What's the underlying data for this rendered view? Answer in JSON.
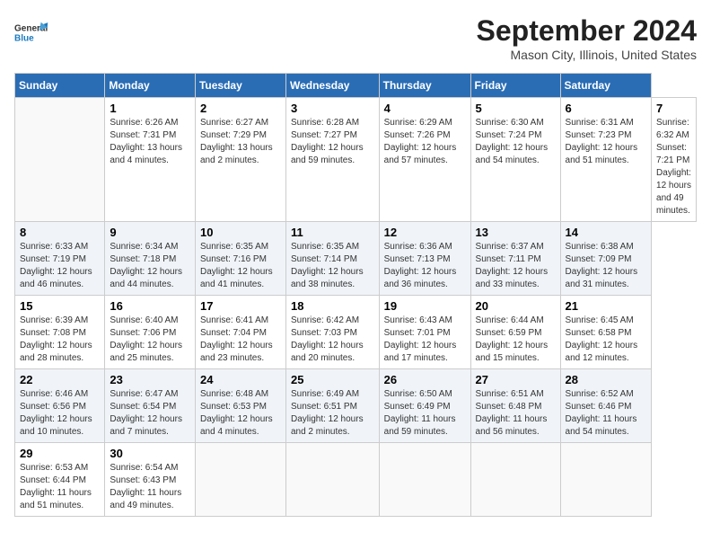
{
  "header": {
    "logo_line1": "General",
    "logo_line2": "Blue",
    "month_title": "September 2024",
    "location": "Mason City, Illinois, United States"
  },
  "calendar": {
    "days_of_week": [
      "Sunday",
      "Monday",
      "Tuesday",
      "Wednesday",
      "Thursday",
      "Friday",
      "Saturday"
    ],
    "weeks": [
      [
        null,
        {
          "day": "1",
          "sunrise": "Sunrise: 6:26 AM",
          "sunset": "Sunset: 7:31 PM",
          "daylight": "Daylight: 13 hours and 4 minutes."
        },
        {
          "day": "2",
          "sunrise": "Sunrise: 6:27 AM",
          "sunset": "Sunset: 7:29 PM",
          "daylight": "Daylight: 13 hours and 2 minutes."
        },
        {
          "day": "3",
          "sunrise": "Sunrise: 6:28 AM",
          "sunset": "Sunset: 7:27 PM",
          "daylight": "Daylight: 12 hours and 59 minutes."
        },
        {
          "day": "4",
          "sunrise": "Sunrise: 6:29 AM",
          "sunset": "Sunset: 7:26 PM",
          "daylight": "Daylight: 12 hours and 57 minutes."
        },
        {
          "day": "5",
          "sunrise": "Sunrise: 6:30 AM",
          "sunset": "Sunset: 7:24 PM",
          "daylight": "Daylight: 12 hours and 54 minutes."
        },
        {
          "day": "6",
          "sunrise": "Sunrise: 6:31 AM",
          "sunset": "Sunset: 7:23 PM",
          "daylight": "Daylight: 12 hours and 51 minutes."
        },
        {
          "day": "7",
          "sunrise": "Sunrise: 6:32 AM",
          "sunset": "Sunset: 7:21 PM",
          "daylight": "Daylight: 12 hours and 49 minutes."
        }
      ],
      [
        {
          "day": "8",
          "sunrise": "Sunrise: 6:33 AM",
          "sunset": "Sunset: 7:19 PM",
          "daylight": "Daylight: 12 hours and 46 minutes."
        },
        {
          "day": "9",
          "sunrise": "Sunrise: 6:34 AM",
          "sunset": "Sunset: 7:18 PM",
          "daylight": "Daylight: 12 hours and 44 minutes."
        },
        {
          "day": "10",
          "sunrise": "Sunrise: 6:35 AM",
          "sunset": "Sunset: 7:16 PM",
          "daylight": "Daylight: 12 hours and 41 minutes."
        },
        {
          "day": "11",
          "sunrise": "Sunrise: 6:35 AM",
          "sunset": "Sunset: 7:14 PM",
          "daylight": "Daylight: 12 hours and 38 minutes."
        },
        {
          "day": "12",
          "sunrise": "Sunrise: 6:36 AM",
          "sunset": "Sunset: 7:13 PM",
          "daylight": "Daylight: 12 hours and 36 minutes."
        },
        {
          "day": "13",
          "sunrise": "Sunrise: 6:37 AM",
          "sunset": "Sunset: 7:11 PM",
          "daylight": "Daylight: 12 hours and 33 minutes."
        },
        {
          "day": "14",
          "sunrise": "Sunrise: 6:38 AM",
          "sunset": "Sunset: 7:09 PM",
          "daylight": "Daylight: 12 hours and 31 minutes."
        }
      ],
      [
        {
          "day": "15",
          "sunrise": "Sunrise: 6:39 AM",
          "sunset": "Sunset: 7:08 PM",
          "daylight": "Daylight: 12 hours and 28 minutes."
        },
        {
          "day": "16",
          "sunrise": "Sunrise: 6:40 AM",
          "sunset": "Sunset: 7:06 PM",
          "daylight": "Daylight: 12 hours and 25 minutes."
        },
        {
          "day": "17",
          "sunrise": "Sunrise: 6:41 AM",
          "sunset": "Sunset: 7:04 PM",
          "daylight": "Daylight: 12 hours and 23 minutes."
        },
        {
          "day": "18",
          "sunrise": "Sunrise: 6:42 AM",
          "sunset": "Sunset: 7:03 PM",
          "daylight": "Daylight: 12 hours and 20 minutes."
        },
        {
          "day": "19",
          "sunrise": "Sunrise: 6:43 AM",
          "sunset": "Sunset: 7:01 PM",
          "daylight": "Daylight: 12 hours and 17 minutes."
        },
        {
          "day": "20",
          "sunrise": "Sunrise: 6:44 AM",
          "sunset": "Sunset: 6:59 PM",
          "daylight": "Daylight: 12 hours and 15 minutes."
        },
        {
          "day": "21",
          "sunrise": "Sunrise: 6:45 AM",
          "sunset": "Sunset: 6:58 PM",
          "daylight": "Daylight: 12 hours and 12 minutes."
        }
      ],
      [
        {
          "day": "22",
          "sunrise": "Sunrise: 6:46 AM",
          "sunset": "Sunset: 6:56 PM",
          "daylight": "Daylight: 12 hours and 10 minutes."
        },
        {
          "day": "23",
          "sunrise": "Sunrise: 6:47 AM",
          "sunset": "Sunset: 6:54 PM",
          "daylight": "Daylight: 12 hours and 7 minutes."
        },
        {
          "day": "24",
          "sunrise": "Sunrise: 6:48 AM",
          "sunset": "Sunset: 6:53 PM",
          "daylight": "Daylight: 12 hours and 4 minutes."
        },
        {
          "day": "25",
          "sunrise": "Sunrise: 6:49 AM",
          "sunset": "Sunset: 6:51 PM",
          "daylight": "Daylight: 12 hours and 2 minutes."
        },
        {
          "day": "26",
          "sunrise": "Sunrise: 6:50 AM",
          "sunset": "Sunset: 6:49 PM",
          "daylight": "Daylight: 11 hours and 59 minutes."
        },
        {
          "day": "27",
          "sunrise": "Sunrise: 6:51 AM",
          "sunset": "Sunset: 6:48 PM",
          "daylight": "Daylight: 11 hours and 56 minutes."
        },
        {
          "day": "28",
          "sunrise": "Sunrise: 6:52 AM",
          "sunset": "Sunset: 6:46 PM",
          "daylight": "Daylight: 11 hours and 54 minutes."
        }
      ],
      [
        {
          "day": "29",
          "sunrise": "Sunrise: 6:53 AM",
          "sunset": "Sunset: 6:44 PM",
          "daylight": "Daylight: 11 hours and 51 minutes."
        },
        {
          "day": "30",
          "sunrise": "Sunrise: 6:54 AM",
          "sunset": "Sunset: 6:43 PM",
          "daylight": "Daylight: 11 hours and 49 minutes."
        },
        null,
        null,
        null,
        null,
        null
      ]
    ]
  }
}
